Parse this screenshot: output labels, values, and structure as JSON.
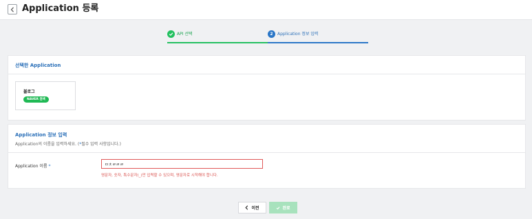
{
  "header": {
    "title": "Application 등록"
  },
  "stepper": {
    "steps": [
      {
        "label": "API 선택",
        "status": "complete"
      },
      {
        "number": "2",
        "label": "Application 정보 입력",
        "status": "active"
      }
    ]
  },
  "selected_section": {
    "title": "선택한 Application",
    "app": {
      "name": "블로그",
      "badge": "NAVER 검색"
    }
  },
  "info_section": {
    "title": "Application 정보 입력",
    "description_prefix": "Application의 이름을 입력하세요. (",
    "required_mark": "*",
    "description_suffix": "필수 입력 사항입니다.)",
    "name_field": {
      "label": "Application 이름",
      "required_mark": "*",
      "value": "ㅁㅊㄹㄹㄹ",
      "error": "영문자, 숫자, 특수문자(_)만 입력할 수 있으며, 영문자로 시작해야 합니다."
    }
  },
  "footer": {
    "prev_label": "이전",
    "done_label": "완료"
  },
  "colors": {
    "primary_blue": "#2a76c7",
    "success_green": "#22c05f",
    "error_red": "#e05757",
    "disabled_green": "#a8e2bd",
    "background": "#f0f1f3"
  },
  "icons": {
    "back": "chevron-left-icon",
    "step_done": "check-icon",
    "prev": "chevron-left-icon",
    "done": "check-icon"
  }
}
